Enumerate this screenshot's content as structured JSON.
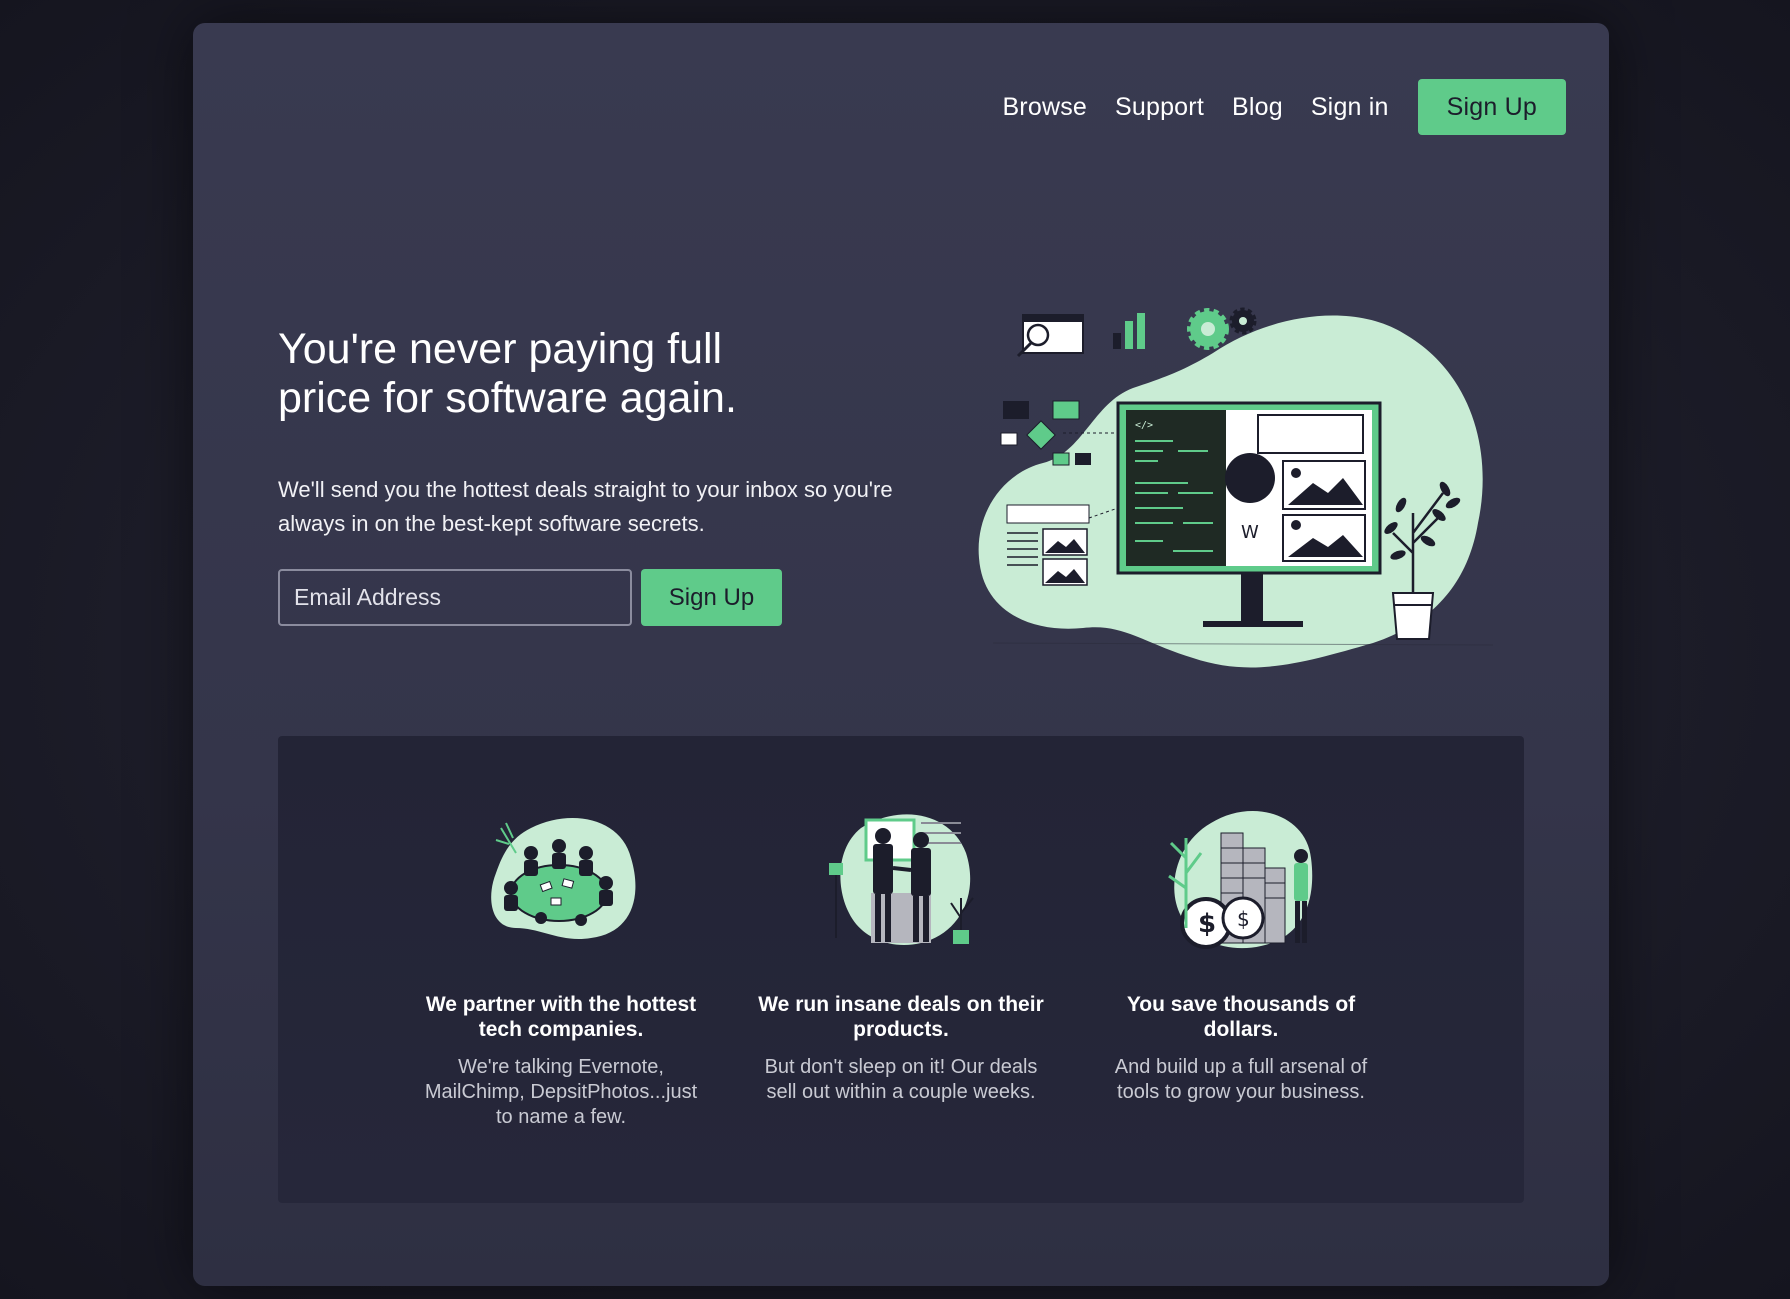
{
  "nav": {
    "links": [
      "Browse",
      "Support",
      "Blog",
      "Sign in"
    ],
    "cta": "Sign Up"
  },
  "hero": {
    "title_line1": "You're never paying full",
    "title_line2": "price for software again.",
    "subtitle": "We'll send you the hottest deals straight to your inbox so you're always in on the best-kept software secrets.",
    "email_placeholder": "Email Address",
    "cta": "Sign Up"
  },
  "features": [
    {
      "title": "We partner with the hottest tech companies.",
      "text": "We're talking Evernote, MailChimp, DepsitPhotos...just to name a few."
    },
    {
      "title": "We run insane deals on their products.",
      "text": "But don't sleep on it! Our deals sell out within a couple weeks."
    },
    {
      "title": "You save thousands of dollars.",
      "text": "And build up a full arsenal of tools to grow your business."
    }
  ],
  "colors": {
    "accent": "#5fcb8a",
    "accent_light": "#c9ecd5",
    "panel": "#393a50",
    "feature_bg": "#232436"
  }
}
